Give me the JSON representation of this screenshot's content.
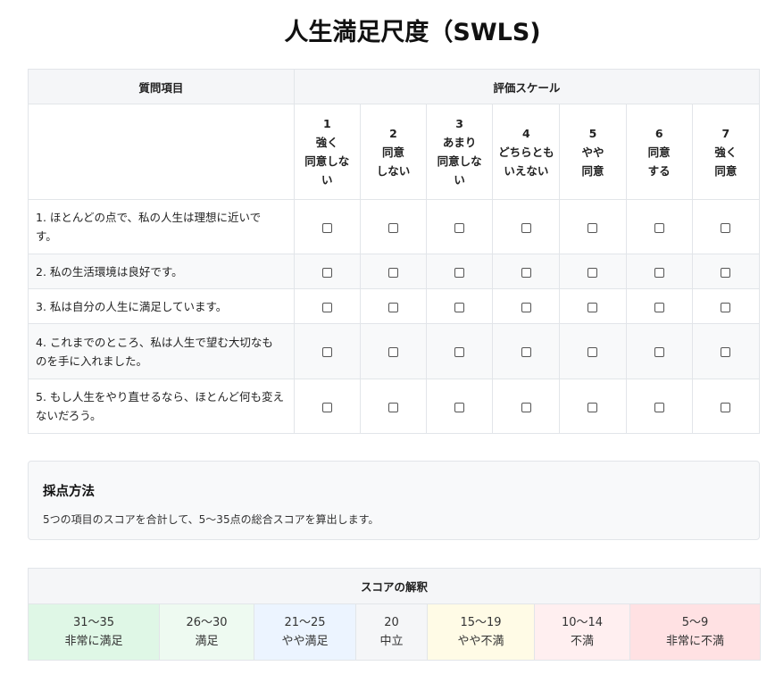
{
  "title": "人生満足尺度（SWLS)",
  "survey": {
    "header_items": "質問項目",
    "header_scale": "評価スケール",
    "scale": [
      {
        "num": "1",
        "lines": [
          "強く",
          "同意しな",
          "い"
        ]
      },
      {
        "num": "2",
        "lines": [
          "同意",
          "しない"
        ]
      },
      {
        "num": "3",
        "lines": [
          "あまり",
          "同意しな",
          "い"
        ]
      },
      {
        "num": "4",
        "lines": [
          "どちらとも",
          "いえない"
        ]
      },
      {
        "num": "5",
        "lines": [
          "やや",
          "同意"
        ]
      },
      {
        "num": "6",
        "lines": [
          "同意",
          "する"
        ]
      },
      {
        "num": "7",
        "lines": [
          "強く",
          "同意"
        ]
      }
    ],
    "items": [
      {
        "lines": [
          "1. ほとんどの点で、私の人生は理想に近いで",
          "す。"
        ]
      },
      {
        "lines": [
          "2. 私の生活環境は良好です。"
        ]
      },
      {
        "lines": [
          "3. 私は自分の人生に満足しています。"
        ]
      },
      {
        "lines": [
          "4. これまでのところ、私は人生で望む大切なも",
          "のを手に入れました。"
        ]
      },
      {
        "lines": [
          "5. もし人生をやり直せるなら、ほとんど何も変え",
          "ないだろう。"
        ]
      }
    ],
    "checkbox_symbol": "checkbox-empty-icon"
  },
  "scoring": {
    "title": "採点方法",
    "description": "5つの項目のスコアを合計して、5〜35点の総合スコアを算出します。"
  },
  "interpretation": {
    "title": "スコアの解釈",
    "ranges": [
      {
        "range": "31〜35",
        "label": "非常に満足",
        "color": "#dff7e6"
      },
      {
        "range": "26〜30",
        "label": "満足",
        "color": "#eefaf1"
      },
      {
        "range": "21〜25",
        "label": "やや満足",
        "color": "#ecf4ff"
      },
      {
        "range": "20",
        "label": "中立",
        "color": "#f5f6f8"
      },
      {
        "range": "15〜19",
        "label": "やや不満",
        "color": "#fffbe6"
      },
      {
        "range": "10〜14",
        "label": "不満",
        "color": "#ffeff0"
      },
      {
        "range": "5〜9",
        "label": "非常に不満",
        "color": "#ffe1e3"
      }
    ]
  }
}
